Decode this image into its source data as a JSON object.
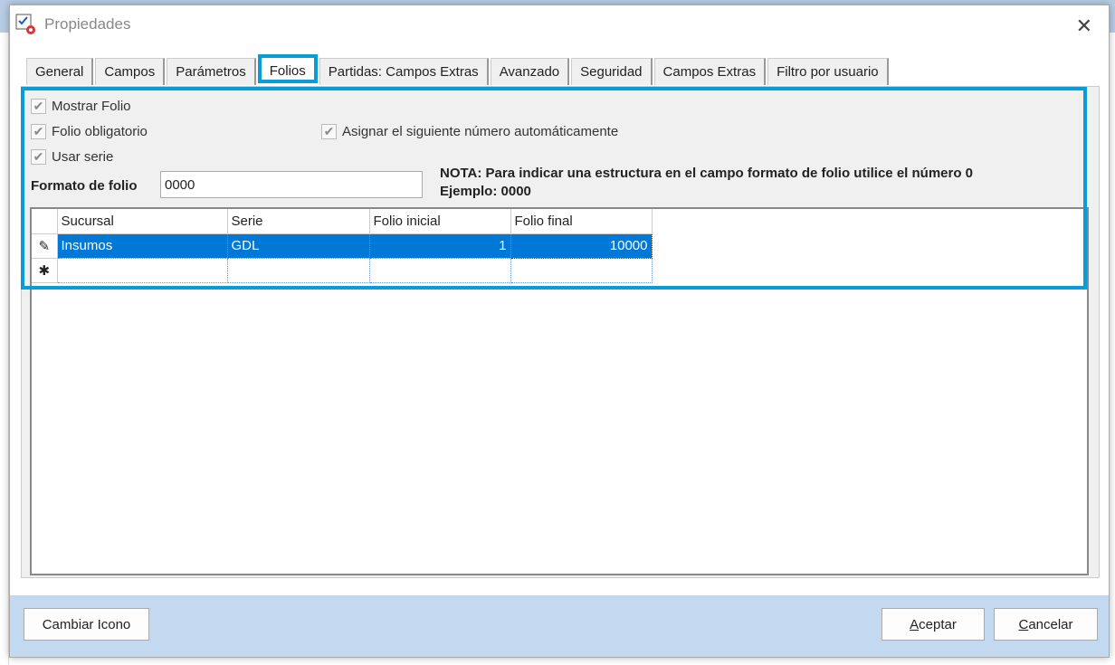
{
  "dialog": {
    "title": "Propiedades"
  },
  "tabs": [
    "General",
    "Campos",
    "Parámetros",
    "Folios",
    "Partidas: Campos Extras",
    "Avanzado",
    "Seguridad",
    "Campos Extras",
    "Filtro por usuario"
  ],
  "active_tab": "Folios",
  "options": {
    "mostrar_folio": "Mostrar Folio",
    "folio_obligatorio": "Folio obligatorio",
    "usar_serie": "Usar serie",
    "asignar": "Asignar el siguiente número automáticamente",
    "formato_label": "Formato de folio",
    "formato_value": "0000",
    "nota_1": "NOTA: Para indicar una estructura en el campo formato  de folio utilice el número 0",
    "nota_2": "Ejemplo: 0000"
  },
  "grid": {
    "columns": [
      "Sucursal",
      "Serie",
      "Folio inicial",
      "Folio final"
    ],
    "rows": [
      {
        "sucursal": "Insumos",
        "serie": "GDL",
        "folio_inicial": "1",
        "folio_final": "10000"
      }
    ]
  },
  "buttons": {
    "cambiar_icono": "Cambiar Icono",
    "aceptar_a": "A",
    "aceptar_rest": "ceptar",
    "cancelar_c": "C",
    "cancelar_rest": "ancelar"
  }
}
